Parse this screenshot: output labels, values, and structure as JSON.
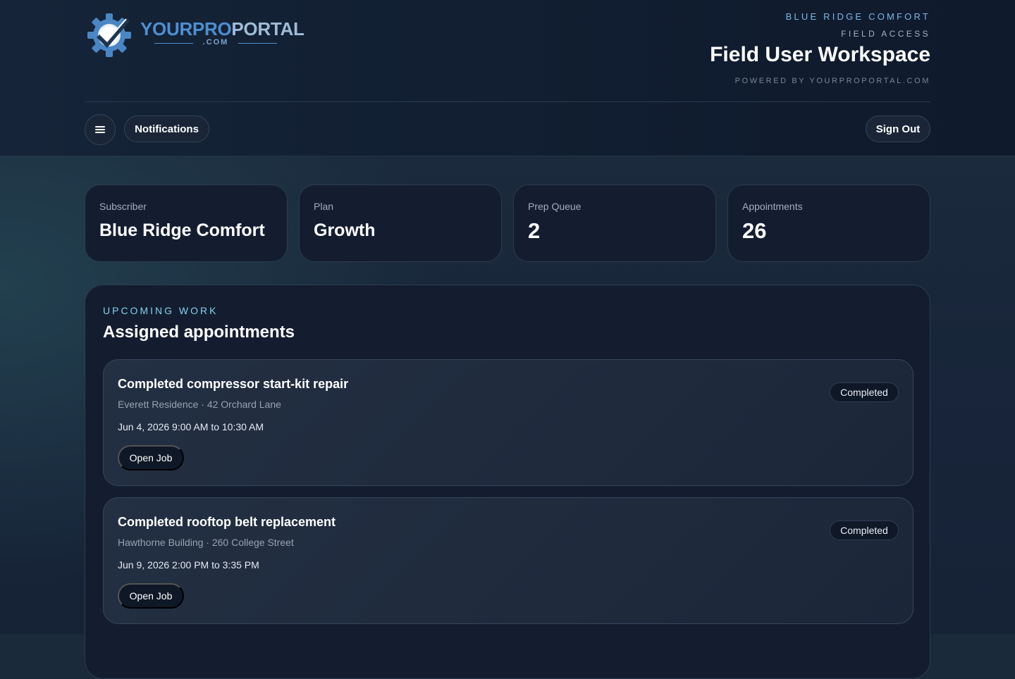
{
  "header": {
    "logo": {
      "text_your": "YOUR",
      "text_pro": "PRO",
      "text_portal": "PORTAL",
      "text_com": ".COM",
      "icon": "gear-check-icon"
    },
    "company_eyebrow": "BLUE RIDGE COMFORT",
    "access_eyebrow": "FIELD ACCESS",
    "title": "Field User Workspace",
    "powered_by": "POWERED BY YOURPROPORTAL.COM"
  },
  "toolbar": {
    "menu_icon": "hamburger-menu-icon",
    "notifications_label": "Notifications",
    "signout_label": "Sign Out"
  },
  "stats": [
    {
      "label": "Subscriber",
      "value": "Blue Ridge Comfort"
    },
    {
      "label": "Plan",
      "value": "Growth"
    },
    {
      "label": "Prep Queue",
      "value": "2"
    },
    {
      "label": "Appointments",
      "value": "26"
    }
  ],
  "upcoming": {
    "eyebrow": "UPCOMING WORK",
    "title": "Assigned appointments",
    "jobs": [
      {
        "title": "Completed compressor start-kit repair",
        "location": "Everett Residence · 42 Orchard Lane",
        "time": "Jun 4, 2026 9:00 AM to 10:30 AM",
        "status": "Completed",
        "action": "Open Job"
      },
      {
        "title": "Completed rooftop belt replacement",
        "location": "Hawthorne Building · 260 College Street",
        "time": "Jun 9, 2026 2:00 PM to 3:35 PM",
        "status": "Completed",
        "action": "Open Job"
      }
    ]
  },
  "colors": {
    "accent_blue": "#4e8fd0",
    "accent_cyan": "#84d0ec",
    "card_bg": "#141d30"
  }
}
